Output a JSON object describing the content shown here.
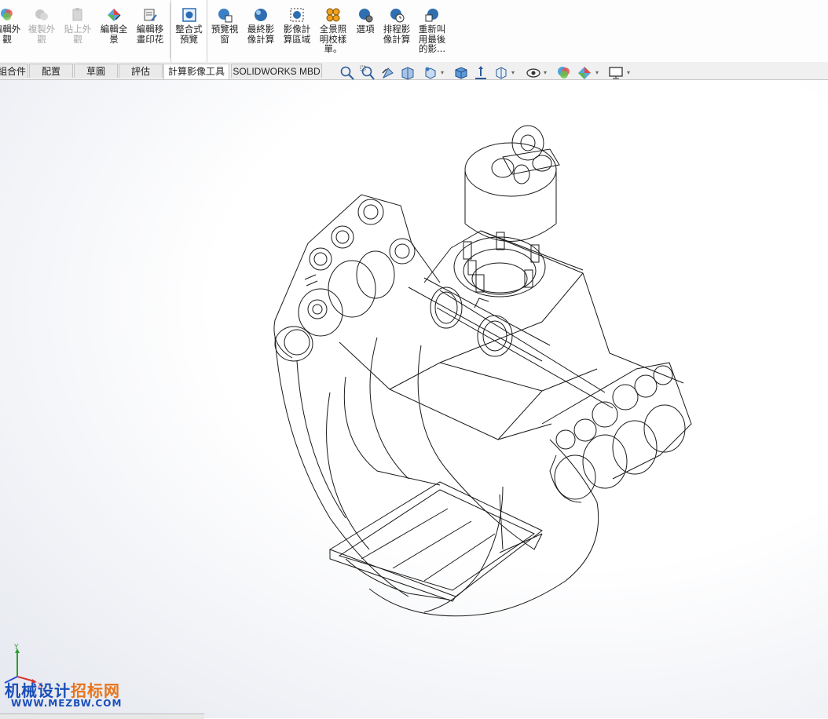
{
  "ribbon": {
    "buttons": [
      {
        "label": "編輯外\n觀",
        "icon": "edit-appearance-icon",
        "state": "enabled"
      },
      {
        "label": "複製外\n觀",
        "icon": "copy-appearance-icon",
        "state": "disabled"
      },
      {
        "label": "貼上外\n觀",
        "icon": "paste-appearance-icon",
        "state": "disabled"
      },
      {
        "label": "編輯全\n景",
        "icon": "edit-scene-icon",
        "state": "enabled"
      },
      {
        "label": "編輯移\n畫印花",
        "icon": "edit-decal-icon",
        "state": "enabled"
      },
      {
        "label": "整合式\n預覽",
        "icon": "integrated-preview-icon",
        "state": "active"
      },
      {
        "label": "預覽視\n窗",
        "icon": "preview-window-icon",
        "state": "enabled"
      },
      {
        "label": "最終影\n像計算",
        "icon": "final-render-icon",
        "state": "enabled"
      },
      {
        "label": "影像計\n算區域",
        "icon": "render-region-icon",
        "state": "enabled"
      },
      {
        "label": "全景照\n明校樣\n單。",
        "icon": "scene-illumination-proof-icon",
        "state": "enabled"
      },
      {
        "label": "選項",
        "icon": "options-icon",
        "state": "enabled"
      },
      {
        "label": "排程影\n像計算",
        "icon": "schedule-render-icon",
        "state": "enabled"
      },
      {
        "label": "重新叫\n用最後\n的影...",
        "icon": "recall-last-render-icon",
        "state": "enabled"
      }
    ]
  },
  "tabs": [
    {
      "label": "組合件"
    },
    {
      "label": "配置"
    },
    {
      "label": "草圖"
    },
    {
      "label": "評估"
    },
    {
      "label": "計算影像工具"
    },
    {
      "label": "SOLIDWORKS MBD"
    }
  ],
  "active_tab": "計算影像工具",
  "headsup_toolbar": [
    "zoom-to-fit-icon",
    "zoom-to-area-icon",
    "previous-view-icon",
    "section-view-icon",
    "dynamic-annotation-icon",
    "view-orientation-icon",
    "display-style-icon",
    "hide-show-items-icon",
    "edit-appearance-icon",
    "apply-scene-icon",
    "view-settings-icon"
  ],
  "triad": {
    "y_label": "Y",
    "x_label": "X"
  },
  "watermark": {
    "cn_part1": "机械设计",
    "cn_part2": "招标网",
    "url": "WWW.MEZBW.COM"
  },
  "colors": {
    "ribbon_bg": "#fdfdfd",
    "watermark_blue": "#1b4fb8",
    "watermark_orange": "#e8741c",
    "model_line": "#1a1a1a"
  }
}
